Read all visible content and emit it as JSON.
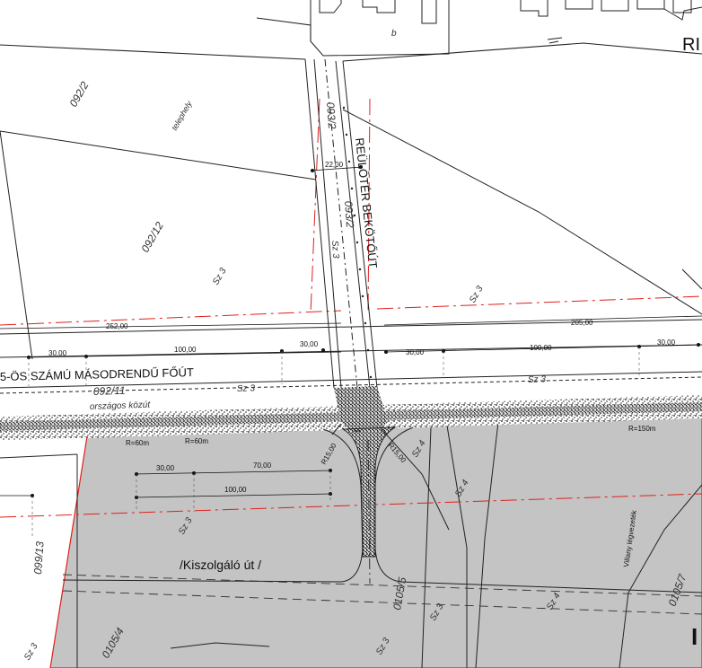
{
  "colors": {
    "background": "#ffffff",
    "shaded_zone": "#c4c4c4",
    "red_line": "#e0201c",
    "line": "#222222",
    "road_stipple": "#1a1a1a"
  },
  "labels": {
    "road_main": "5-ÖS SZÁMÚ MÁSODRENDŰ FŐÚT",
    "road_connector": "REÜLŐTÉR BEKÖTŐÚT",
    "top_right": "RI",
    "service_road": "/Kiszolgáló út /",
    "powerline": "Villany légvezeték",
    "country_road": "országos közút",
    "plot_site": "telephely",
    "right_edge": "I"
  },
  "parcels": [
    "092/2",
    "092/12",
    "092/11",
    "093/2",
    "093/2",
    "0105/4",
    "0105/5",
    "0105/7",
    "099/13"
  ],
  "zone_codes": [
    "Sz 3",
    "Sz 3",
    "Sz 3",
    "Sz 3",
    "Sz 4",
    "Sz 4",
    "Sz 3",
    "Sz 3",
    "Sz 3",
    "Sz 4",
    "Sz 3",
    "Sz 3"
  ],
  "dims": {
    "connector_width": "22,00",
    "left_total": "252,00",
    "right_total": "205,00",
    "left_30a": "30,00",
    "left_100": "100,00",
    "left_30b": "30,00",
    "right_30a": "30,00",
    "right_100": "100,00",
    "right_30b": "30,00",
    "lower_30": "30,00",
    "lower_70": "70,00",
    "lower_100": "100,00"
  },
  "radii": {
    "r60a": "R=60m",
    "r60b": "R=60m",
    "r150": "R=150m",
    "r15a": "R15,00",
    "r15b": "R15,00"
  },
  "building_letter": "b"
}
